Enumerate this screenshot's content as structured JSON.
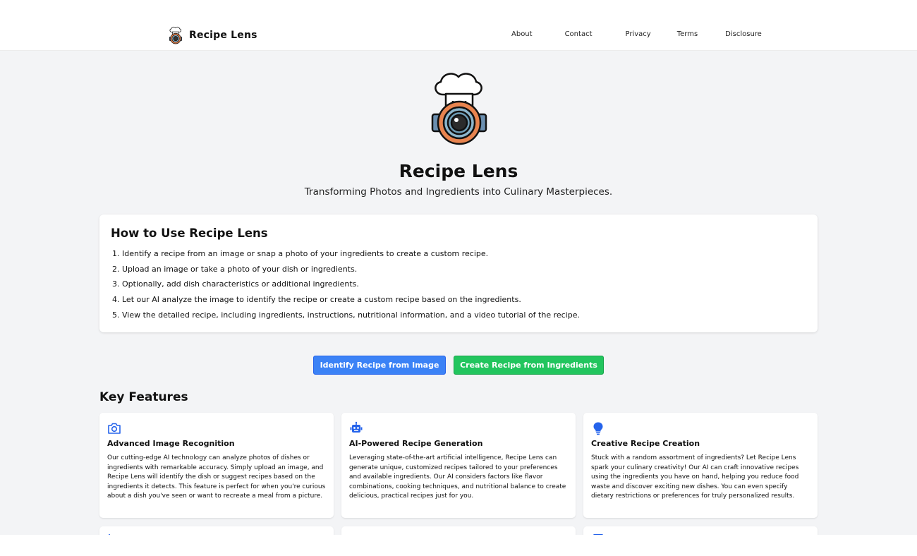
{
  "nav": {
    "brand": "Recipe Lens",
    "links": [
      "About",
      "Contact",
      "Privacy",
      "Terms",
      "Disclosure"
    ]
  },
  "hero": {
    "title": "Recipe Lens",
    "subtitle": "Transforming Photos and Ingredients into Culinary Masterpieces."
  },
  "howto": {
    "title": "How to Use Recipe Lens",
    "steps": [
      "Identify a recipe from an image or snap a photo of your ingredients to create a custom recipe.",
      "Upload an image or take a photo of your dish or ingredients.",
      "Optionally, add dish characteristics or additional ingredients.",
      "Let our AI analyze the image to identify the recipe or create a custom recipe based on the ingredients.",
      "View the detailed recipe, including ingredients, instructions, nutritional information, and a video tutorial of the recipe."
    ]
  },
  "buttons": {
    "identify": "Identify Recipe from Image",
    "create": "Create Recipe from Ingredients"
  },
  "features": {
    "title": "Key Features",
    "items": [
      {
        "icon": "camera-icon",
        "title": "Advanced Image Recognition",
        "text": "Our cutting-edge AI technology can analyze photos of dishes or ingredients with remarkable accuracy. Simply upload an image, and Recipe Lens will identify the dish or suggest recipes based on the ingredients it detects. This feature is perfect for when you're curious about a dish you've seen or want to recreate a meal from a picture."
      },
      {
        "icon": "robot-icon",
        "title": "AI-Powered Recipe Generation",
        "text": "Leveraging state-of-the-art artificial intelligence, Recipe Lens can generate unique, customized recipes tailored to your preferences and available ingredients. Our AI considers factors like flavor combinations, cooking techniques, and nutritional balance to create delicious, practical recipes just for you."
      },
      {
        "icon": "lightbulb-icon",
        "title": "Creative Recipe Creation",
        "text": "Stuck with a random assortment of ingredients? Let Recipe Lens spark your culinary creativity! Our AI can craft innovative recipes using the ingredients you have on hand, helping you reduce food waste and discover exciting new dishes. You can even specify dietary restrictions or preferences for truly personalized results."
      }
    ]
  },
  "colors": {
    "blue": "#3b82f6",
    "green": "#22c55e",
    "page_bg": "#f3f4f6",
    "icon_blue": "#2563eb"
  }
}
